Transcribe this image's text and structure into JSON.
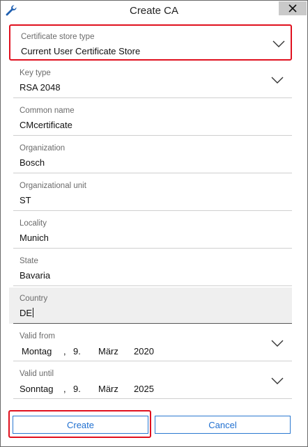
{
  "window": {
    "title": "Create CA"
  },
  "fields": {
    "store_type": {
      "label": "Certificate store type",
      "value": "Current User Certificate Store"
    },
    "key_type": {
      "label": "Key type",
      "value": "RSA 2048"
    },
    "common_name": {
      "label": "Common name",
      "value": "CMcertificate"
    },
    "organization": {
      "label": "Organization",
      "value": "Bosch"
    },
    "org_unit": {
      "label": "Organizational unit",
      "value": "ST"
    },
    "locality": {
      "label": "Locality",
      "value": "Munich"
    },
    "state": {
      "label": "State",
      "value": "Bavaria"
    },
    "country": {
      "label": "Country",
      "value": "DE"
    },
    "valid_from": {
      "label": "Valid from",
      "weekday": "Montag",
      "sep": ",",
      "day": "9.",
      "month": "März",
      "year": "2020"
    },
    "valid_until": {
      "label": "Valid until",
      "weekday": "Sonntag",
      "sep": ",",
      "day": "9.",
      "month": "März",
      "year": "2025"
    }
  },
  "buttons": {
    "create": "Create",
    "cancel": "Cancel"
  },
  "colors": {
    "highlight": "#e0101e",
    "button_accent": "#1f6fd0"
  },
  "icons": {
    "app": "wrench-icon",
    "close": "close-icon",
    "dropdown": "chevron-down-icon"
  }
}
